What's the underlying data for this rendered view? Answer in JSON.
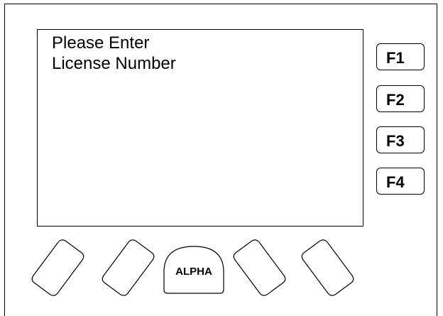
{
  "screen": {
    "prompt_line_1": "Please Enter",
    "prompt_line_2": "License Number"
  },
  "function_keys": [
    {
      "label": "F1"
    },
    {
      "label": "F2"
    },
    {
      "label": "F3"
    },
    {
      "label": "F4"
    }
  ],
  "soft_keys": {
    "alpha_label": "ALPHA"
  },
  "colors": {
    "outline": "#000000",
    "background": "#ffffff"
  }
}
